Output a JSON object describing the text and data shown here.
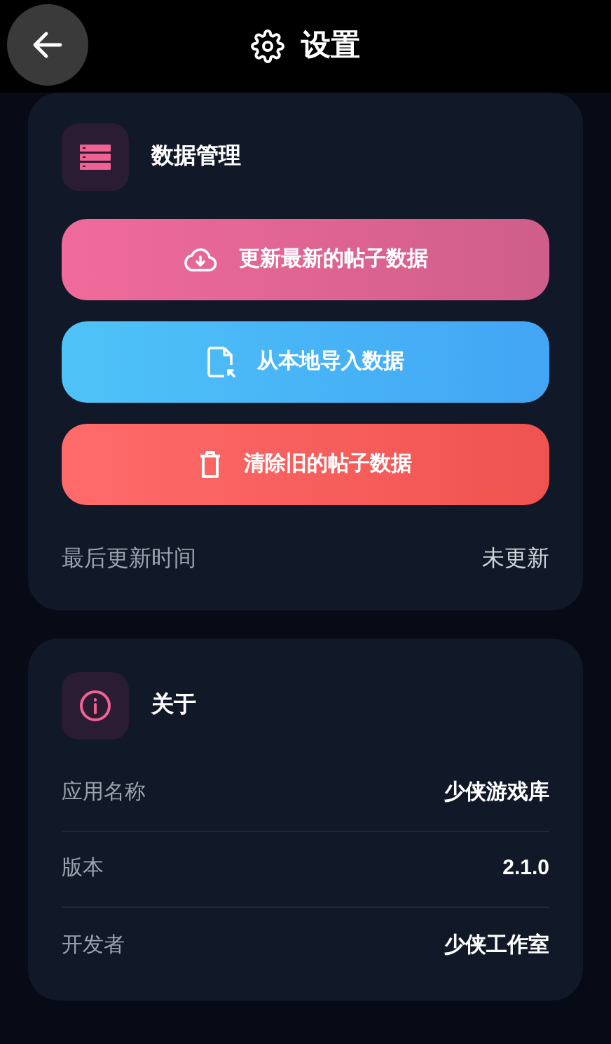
{
  "header": {
    "title": "设置"
  },
  "data_section": {
    "title": "数据管理",
    "actions": [
      {
        "kind": "update",
        "label": "更新最新的帖子数据"
      },
      {
        "kind": "import",
        "label": "从本地导入数据"
      },
      {
        "kind": "clear",
        "label": "清除旧的帖子数据"
      }
    ],
    "last_update": {
      "label": "最后更新时间",
      "value": "未更新"
    }
  },
  "about_section": {
    "title": "关于",
    "rows": [
      {
        "label": "应用名称",
        "value": "少侠游戏库"
      },
      {
        "label": "版本",
        "value": "2.1.0"
      },
      {
        "label": "开发者",
        "value": "少侠工作室"
      }
    ]
  }
}
